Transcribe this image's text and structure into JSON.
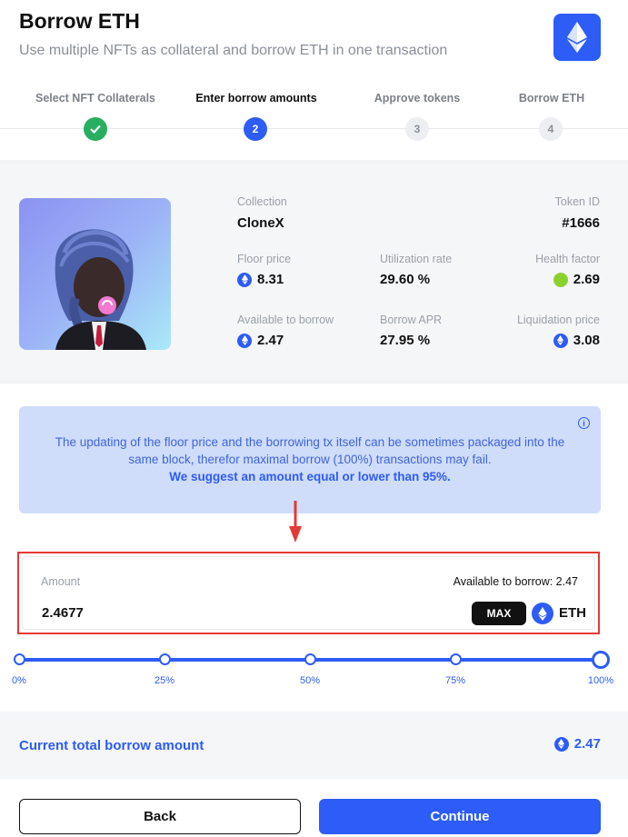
{
  "header": {
    "title": "Borrow ETH",
    "subtitle": "Use multiple NFTs as collateral and borrow ETH in one transaction",
    "logo_icon": "ethereum-icon"
  },
  "steps": [
    {
      "label": "Select NFT Collaterals",
      "marker": "",
      "state": "done"
    },
    {
      "label": "Enter borrow amounts",
      "marker": "2",
      "state": "current"
    },
    {
      "label": "Approve tokens",
      "marker": "3",
      "state": "pending"
    },
    {
      "label": "Borrow ETH",
      "marker": "4",
      "state": "pending"
    }
  ],
  "nft": {
    "collection_label": "Collection",
    "collection_value": "CloneX",
    "token_id_label": "Token ID",
    "token_id_value": "#1666",
    "floor_price_label": "Floor price",
    "floor_price_value": "8.31",
    "utilization_label": "Utilization rate",
    "utilization_value": "29.60 %",
    "health_label": "Health factor",
    "health_value": "2.69",
    "available_label": "Available to borrow",
    "available_value": "2.47",
    "apr_label": "Borrow APR",
    "apr_value": "27.95 %",
    "liquidation_label": "Liquidation price",
    "liquidation_value": "3.08"
  },
  "notice": {
    "text": "The updating of the floor price and the borrowing tx itself can be sometimes packaged into the same block, therefor maximal borrow (100%) transactions may fail.",
    "strong": "We suggest an amount equal or lower than 95%."
  },
  "amount": {
    "label": "Amount",
    "available": "Available to borrow: 2.47",
    "value": "2.4677",
    "max_label": "MAX",
    "unit": "ETH"
  },
  "slider": {
    "labels": [
      "0%",
      "25%",
      "50%",
      "75%",
      "100%"
    ],
    "value_percent": 100
  },
  "total": {
    "label": "Current total borrow amount",
    "value": "2.47"
  },
  "buttons": {
    "back": "Back",
    "continue": "Continue"
  },
  "colors": {
    "accent": "#2d5cf6",
    "success": "#27ae60",
    "highlight": "#e53935"
  }
}
